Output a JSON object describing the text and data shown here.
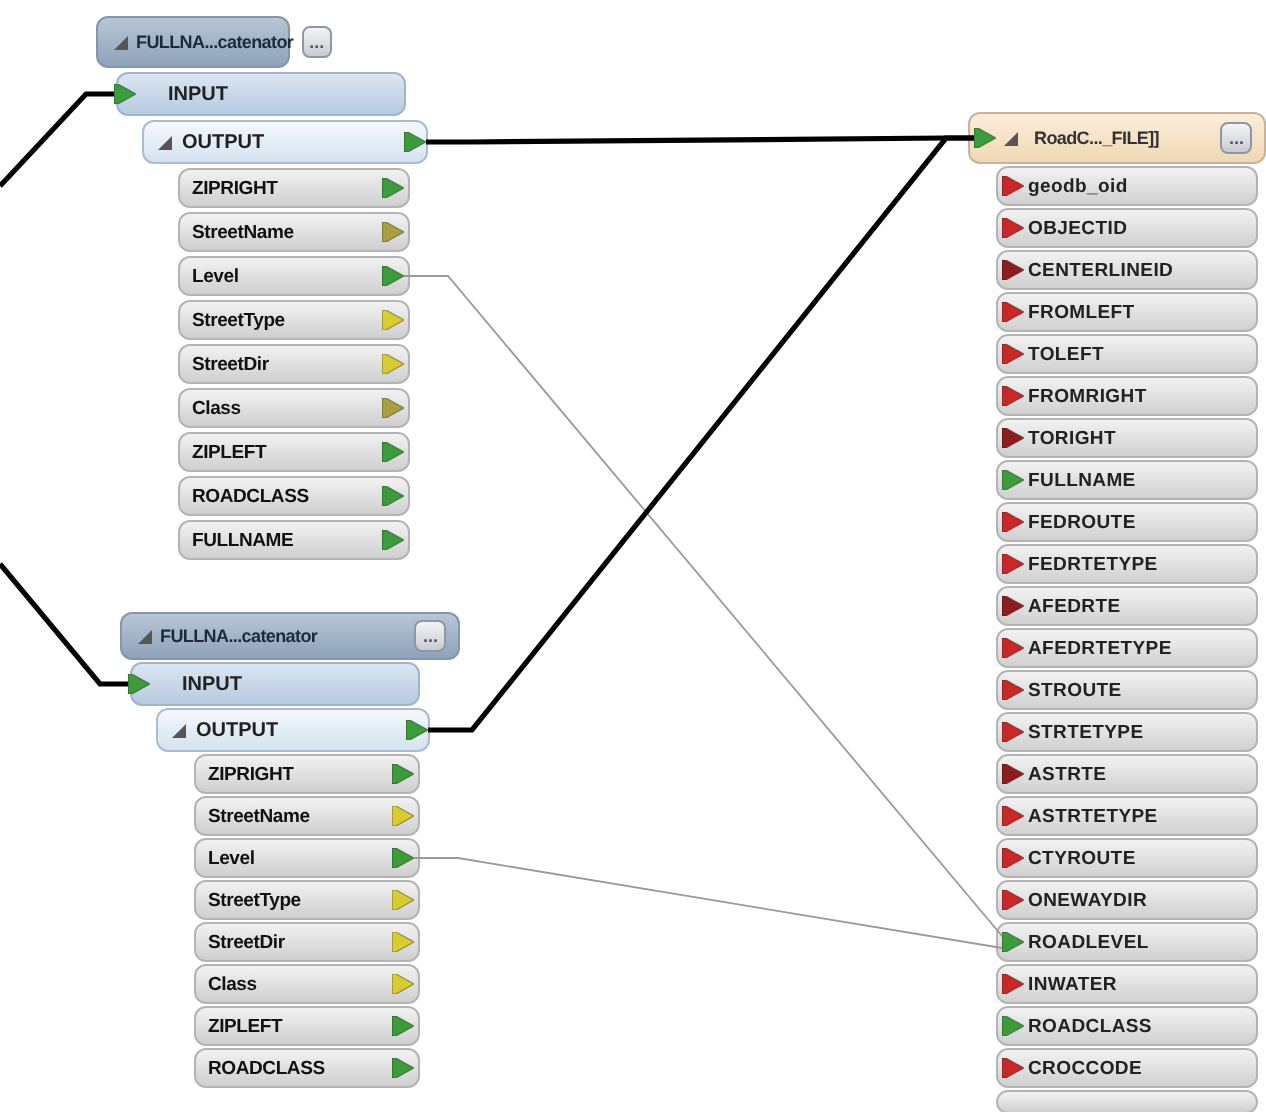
{
  "transformers": [
    {
      "title": "FULLNA...catenator",
      "menu_button": "...",
      "input": "INPUT",
      "input_connected": true,
      "output": "OUTPUT",
      "output_connected": true,
      "attributes": [
        {
          "name": "ZIPRIGHT",
          "color": "#3c9c3c"
        },
        {
          "name": "StreetName",
          "color": "#a8a040"
        },
        {
          "name": "Level",
          "color": "#3c9c3c",
          "linked": true
        },
        {
          "name": "StreetType",
          "color": "#d8cc30"
        },
        {
          "name": "StreetDir",
          "color": "#d8cc30"
        },
        {
          "name": "Class",
          "color": "#a8a040"
        },
        {
          "name": "ZIPLEFT",
          "color": "#3c9c3c"
        },
        {
          "name": "ROADCLASS",
          "color": "#3c9c3c"
        },
        {
          "name": "FULLNAME",
          "color": "#3c9c3c"
        }
      ]
    },
    {
      "title": "FULLNA...catenator",
      "menu_button": "...",
      "input": "INPUT",
      "input_connected": true,
      "output": "OUTPUT",
      "output_connected": true,
      "attributes": [
        {
          "name": "ZIPRIGHT",
          "color": "#3c9c3c"
        },
        {
          "name": "StreetName",
          "color": "#d8cc30"
        },
        {
          "name": "Level",
          "color": "#3c9c3c",
          "linked": true
        },
        {
          "name": "StreetType",
          "color": "#d8cc30"
        },
        {
          "name": "StreetDir",
          "color": "#d8cc30"
        },
        {
          "name": "Class",
          "color": "#d8cc30"
        },
        {
          "name": "ZIPLEFT",
          "color": "#3c9c3c"
        },
        {
          "name": "ROADCLASS",
          "color": "#3c9c3c"
        }
      ]
    }
  ],
  "writer": {
    "title": "RoadC..._FILE]]",
    "menu_button": "...",
    "attributes": [
      {
        "name": "geodb_oid",
        "color": "#c82828"
      },
      {
        "name": "OBJECTID",
        "color": "#c82828"
      },
      {
        "name": "CENTERLINEID",
        "color": "#8c1e1e"
      },
      {
        "name": "FROMLEFT",
        "color": "#c82828"
      },
      {
        "name": "TOLEFT",
        "color": "#c82828"
      },
      {
        "name": "FROMRIGHT",
        "color": "#c82828"
      },
      {
        "name": "TORIGHT",
        "color": "#8c1e1e"
      },
      {
        "name": "FULLNAME",
        "color": "#3c9c3c"
      },
      {
        "name": "FEDROUTE",
        "color": "#c82828"
      },
      {
        "name": "FEDRTETYPE",
        "color": "#c82828"
      },
      {
        "name": "AFEDRTE",
        "color": "#8c1e1e"
      },
      {
        "name": "AFEDRTETYPE",
        "color": "#c82828"
      },
      {
        "name": "STROUTE",
        "color": "#c82828"
      },
      {
        "name": "STRTETYPE",
        "color": "#c82828"
      },
      {
        "name": "ASTRTE",
        "color": "#8c1e1e"
      },
      {
        "name": "ASTRTETYPE",
        "color": "#c82828"
      },
      {
        "name": "CTYROUTE",
        "color": "#c82828"
      },
      {
        "name": "ONEWAYDIR",
        "color": "#c82828"
      },
      {
        "name": "ROADLEVEL",
        "color": "#3c9c3c",
        "linked": true
      },
      {
        "name": "INWATER",
        "color": "#c82828"
      },
      {
        "name": "ROADCLASS",
        "color": "#3c9c3c"
      },
      {
        "name": "CROCCODE",
        "color": "#c82828"
      }
    ]
  }
}
